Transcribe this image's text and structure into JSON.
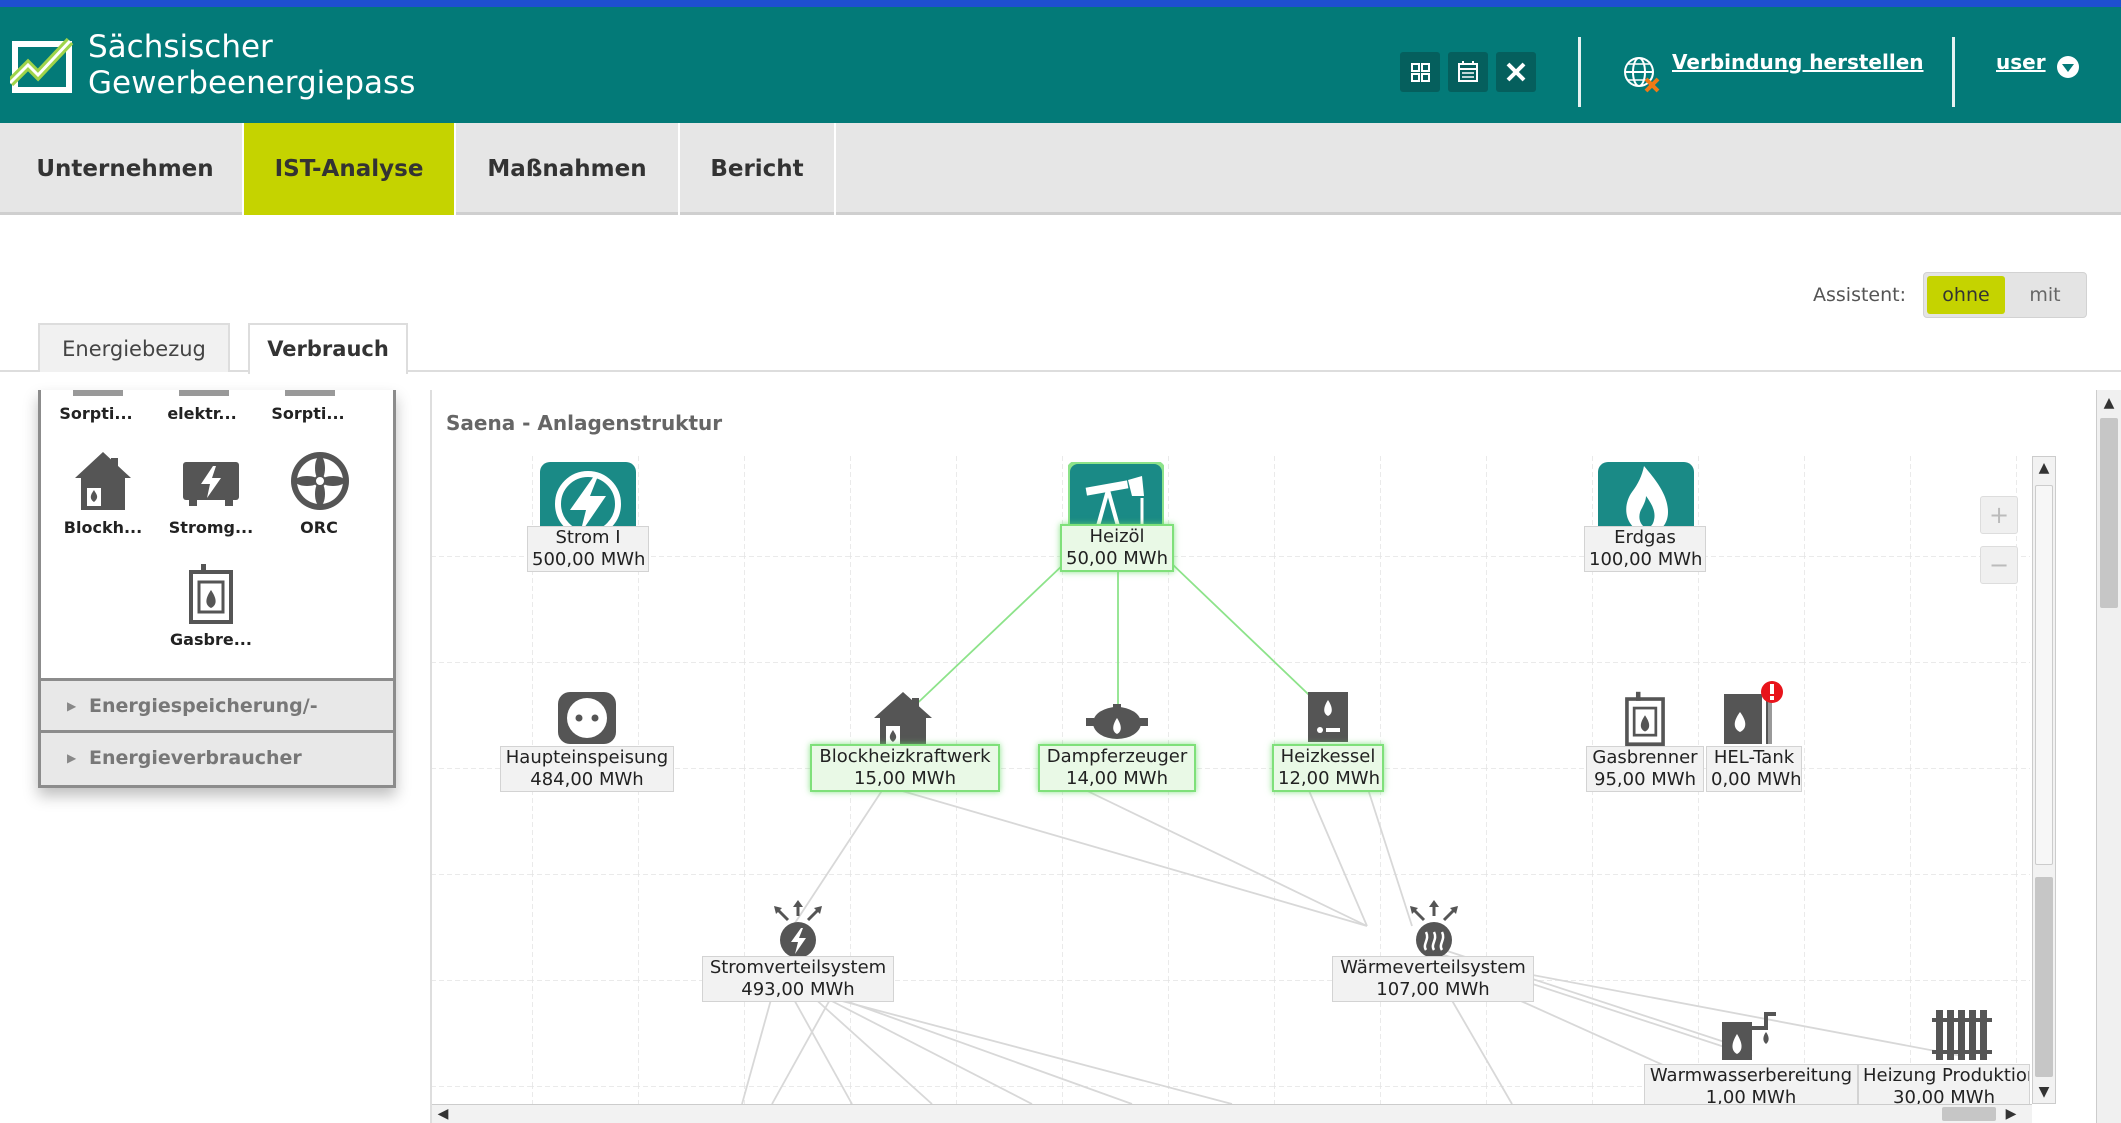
{
  "app": {
    "title_line1": "Sächsischer",
    "title_line2": "Gewerbeenergiepass"
  },
  "header": {
    "connect_label": "Verbindung herstellen",
    "user_label": "user",
    "icons": [
      "grid-icon",
      "calendar-icon",
      "close-icon",
      "globe-disconnected-icon",
      "chevron-down-icon"
    ]
  },
  "main_nav": {
    "tabs": [
      {
        "label": "Unternehmen",
        "active": false
      },
      {
        "label": "IST-Analyse",
        "active": true
      },
      {
        "label": "Maßnahmen",
        "active": false
      },
      {
        "label": "Bericht",
        "active": false
      }
    ]
  },
  "assistant": {
    "label": "Assistent:",
    "options": [
      "ohne",
      "mit"
    ],
    "selected": "ohne"
  },
  "sub_tabs": [
    {
      "label": "Energiebezug",
      "active": false
    },
    {
      "label": "Verbrauch",
      "active": true
    }
  ],
  "palette": {
    "items": [
      {
        "label": "Sorpti...",
        "icon": "sorption-icon"
      },
      {
        "label": "elektr...",
        "icon": "electric-icon"
      },
      {
        "label": "Sorpti...",
        "icon": "sorption-icon"
      },
      {
        "label": "Blockh...",
        "icon": "chp-house-icon"
      },
      {
        "label": "Stromg...",
        "icon": "generator-icon"
      },
      {
        "label": "ORC",
        "icon": "fan-icon"
      },
      {
        "label": "Gasbre...",
        "icon": "gas-burner-icon"
      }
    ],
    "sections": [
      {
        "label": "Energiespeicherung/-transport"
      },
      {
        "label": "Energieverbraucher"
      }
    ]
  },
  "diagram": {
    "title": "Saena - Anlagenstruktur",
    "nodes": [
      {
        "id": "strom",
        "name": "Strom I",
        "value": "500,00 MWh",
        "icon": "lightning-icon",
        "selected": false
      },
      {
        "id": "heizoel",
        "name": "Heizöl",
        "value": "50,00 MWh",
        "icon": "oil-pump-icon",
        "selected": true
      },
      {
        "id": "erdgas",
        "name": "Erdgas",
        "value": "100,00 MWh",
        "icon": "flame-icon",
        "selected": false
      },
      {
        "id": "haupt",
        "name": "Haupteinspeisung",
        "value": "484,00 MWh",
        "icon": "socket-icon",
        "selected": false
      },
      {
        "id": "bhkw",
        "name": "Blockheizkraftwerk",
        "value": "15,00 MWh",
        "icon": "chp-house-icon",
        "selected": true
      },
      {
        "id": "dampf",
        "name": "Dampferzeuger",
        "value": "14,00 MWh",
        "icon": "steam-generator-icon",
        "selected": true
      },
      {
        "id": "heizkessel",
        "name": "Heizkessel",
        "value": "12,00 MWh",
        "icon": "boiler-icon",
        "selected": true
      },
      {
        "id": "gasbrenner",
        "name": "Gasbrenner",
        "value": "95,00 MWh",
        "icon": "gas-burner-icon",
        "selected": false
      },
      {
        "id": "heltank",
        "name": "HEL-Tank",
        "value": "0,00 MWh",
        "icon": "tank-icon",
        "selected": false
      },
      {
        "id": "stromvert",
        "name": "Stromverteilsystem",
        "value": "493,00 MWh",
        "icon": "power-distribution-icon",
        "selected": false
      },
      {
        "id": "waermevert",
        "name": "Wärmeverteilsystem",
        "value": "107,00 MWh",
        "icon": "heat-distribution-icon",
        "selected": false
      },
      {
        "id": "warmwasser",
        "name": "Warmwasserbereitung",
        "value": "1,00 MWh",
        "icon": "hot-water-icon",
        "selected": false
      },
      {
        "id": "heizprod",
        "name": "Heizung Produktion",
        "value": "30,00 MWh",
        "icon": "radiator-icon",
        "selected": false
      }
    ],
    "zoom_in": "+",
    "zoom_out": "−"
  },
  "colors": {
    "header_bg": "#037a78",
    "accent": "#c5d300",
    "node_teal": "#1a8a86",
    "selected_glow": "#7fe07a",
    "warning": "#e8141b"
  }
}
